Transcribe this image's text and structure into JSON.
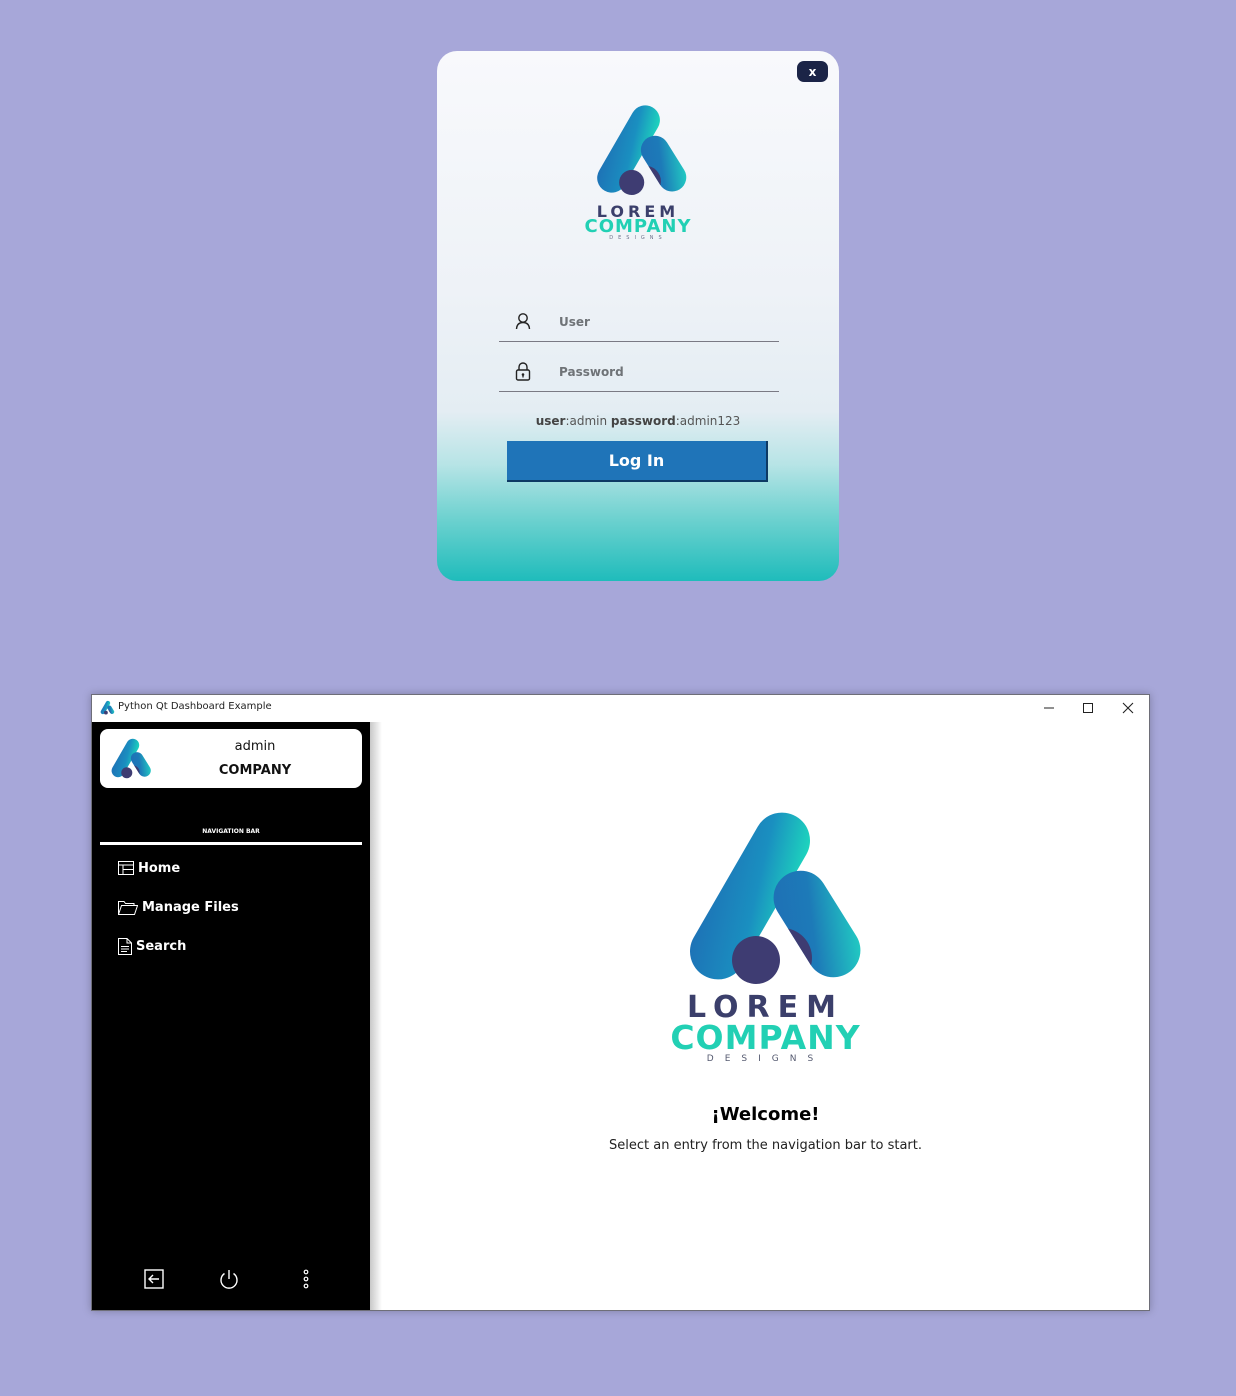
{
  "login": {
    "close_label": "x",
    "logo": {
      "line1": "LOREM",
      "line2": "COMPANY",
      "line3": "DESIGNS"
    },
    "user_placeholder": "User",
    "password_placeholder": "Password",
    "hint": {
      "user_key": "user",
      "user_value": "admin",
      "password_key": "password",
      "password_value": "admin123"
    },
    "login_button": "Log In"
  },
  "window": {
    "title": "Python Qt Dashboard Example",
    "controls": {
      "minimize": "minimize-icon",
      "maximize": "maximize-icon",
      "close": "close-icon"
    }
  },
  "sidebar": {
    "user_name": "admin",
    "company": "COMPANY",
    "nav_label": "NAVIGATION BAR",
    "items": [
      {
        "label": "Home",
        "icon": "layout-icon"
      },
      {
        "label": "Manage Files",
        "icon": "folder-icon"
      },
      {
        "label": "Search",
        "icon": "document-icon"
      }
    ],
    "footer_icons": [
      "logout-icon",
      "power-icon",
      "more-vertical-icon"
    ]
  },
  "main": {
    "logo": {
      "line1": "LOREM",
      "line2": "COMPANY",
      "line3": "DESIGNS"
    },
    "welcome": "¡Welcome!",
    "subtitle": "Select an entry from the navigation bar to start."
  },
  "colors": {
    "background": "#a7a7d9",
    "accent_blue": "#1f74b8",
    "teal": "#22d0b4",
    "navy": "#3b3f6b",
    "sidebar": "#000000"
  }
}
